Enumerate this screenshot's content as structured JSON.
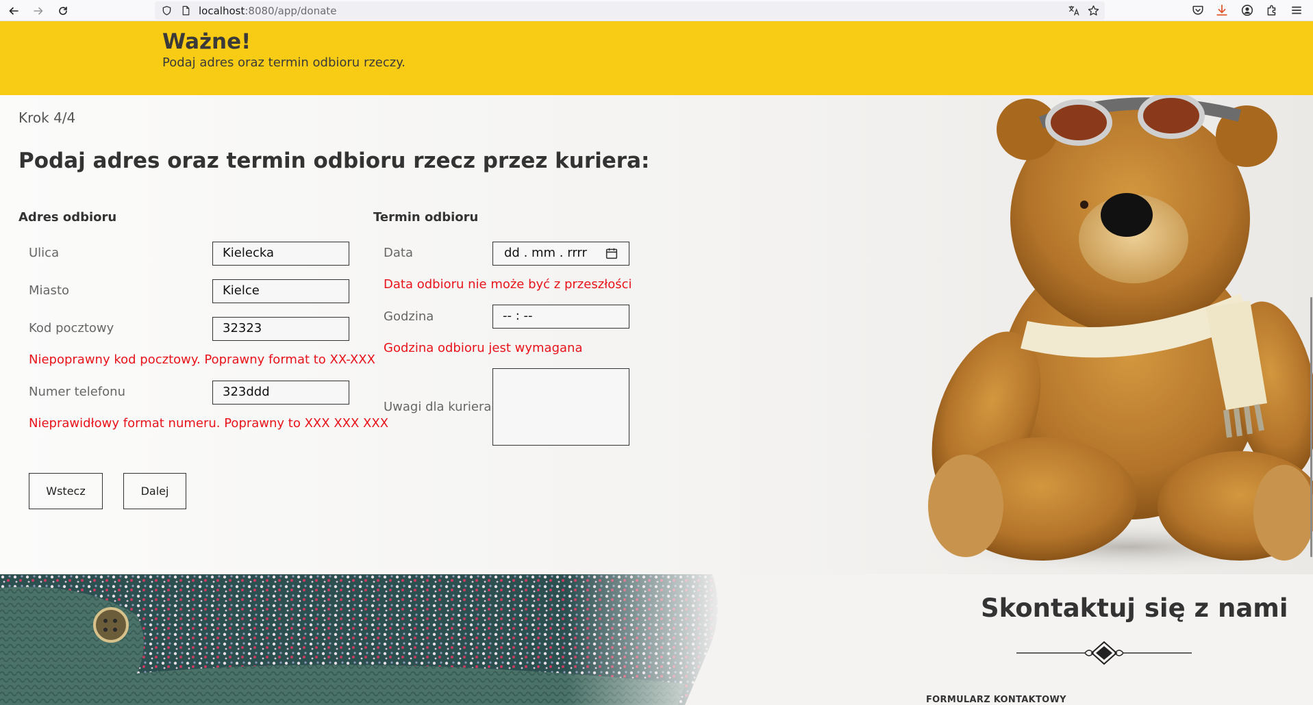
{
  "browser": {
    "url_host": "localhost",
    "url_rest": ":8080/app/donate"
  },
  "banner": {
    "title": "Ważne!",
    "text": "Podaj adres oraz termin odbioru rzeczy."
  },
  "form": {
    "step": "Krok 4/4",
    "heading": "Podaj adres oraz termin odbioru rzecz przez kuriera:",
    "address": {
      "title": "Adres odbioru",
      "street_label": "Ulica",
      "street_value": "Kielecka",
      "city_label": "Miasto",
      "city_value": "Kielce",
      "postcode_label": "Kod pocztowy",
      "postcode_value": "32323",
      "postcode_error": "Niepoprawny kod pocztowy. Poprawny format to XX-XXX",
      "phone_label": "Numer telefonu",
      "phone_value": "323ddd",
      "phone_error": "Nieprawidłowy format numeru. Poprawny to XXX XXX XXX"
    },
    "pickup": {
      "title": "Termin odbioru",
      "date_label": "Data",
      "date_placeholder": "dd . mm . rrrr",
      "date_error": "Data odbioru nie może być z przeszłości",
      "time_label": "Godzina",
      "time_placeholder": "-- : --",
      "time_error": "Godzina odbioru jest wymagana",
      "notes_label": "Uwagi dla kuriera"
    },
    "back_button": "Wstecz",
    "next_button": "Dalej"
  },
  "footer": {
    "title": "Skontaktuj się z nami",
    "subtitle": "FORMULARZ KONTAKTOWY"
  },
  "colors": {
    "banner": "#f8cc14",
    "error": "#e8131a",
    "text": "#3a3a3a"
  },
  "icons": [
    "back-arrow-icon",
    "forward-arrow-icon",
    "reload-icon",
    "shield-icon",
    "page-icon",
    "translate-icon",
    "bookmark-star-icon",
    "pocket-icon",
    "download-icon",
    "account-icon",
    "extensions-icon",
    "menu-icon",
    "calendar-icon"
  ]
}
